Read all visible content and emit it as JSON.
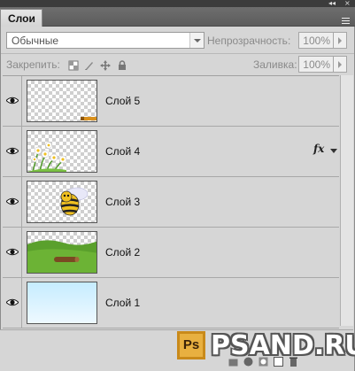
{
  "panel": {
    "tab_label": "Слои",
    "blend_mode": "Обычные",
    "opacity_label": "Непрозрачность:",
    "opacity_value": "100%",
    "lock_label": "Закрепить:",
    "fill_label": "Заливка:",
    "fill_value": "100%"
  },
  "layers": [
    {
      "name": "Слой 5",
      "visible": true,
      "content": "logo-stamp",
      "fx": ""
    },
    {
      "name": "Слой 4",
      "visible": true,
      "content": "daisies",
      "fx": "fx"
    },
    {
      "name": "Слой 3",
      "visible": true,
      "content": "bee",
      "fx": ""
    },
    {
      "name": "Слой 2",
      "visible": true,
      "content": "grass-log",
      "fx": ""
    },
    {
      "name": "Слой 1",
      "visible": true,
      "content": "sky-gradient",
      "fx": ""
    }
  ],
  "watermark": {
    "badge": "Ps",
    "text": "PSAND.RU"
  },
  "colors": {
    "panel_bg": "#d6d6d6",
    "grass": "#5aa02c",
    "sky": "#d8f2ff"
  }
}
